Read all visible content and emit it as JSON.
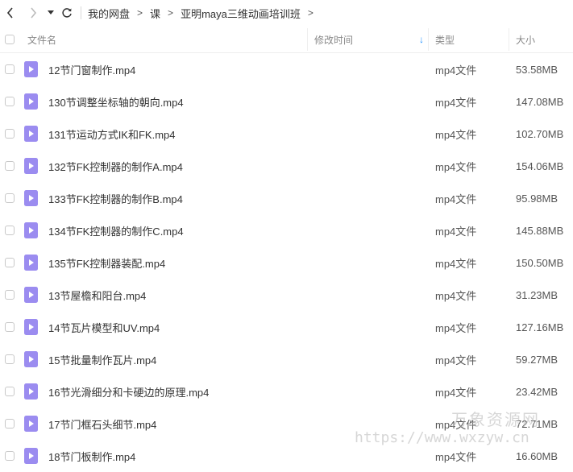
{
  "breadcrumb": [
    "我的网盘",
    "课",
    "亚明maya三维动画培训班"
  ],
  "breadcrumb_sep": ">",
  "columns": {
    "name": "文件名",
    "modified": "修改时间",
    "type": "类型",
    "size": "大小"
  },
  "sort_indicator": "↓",
  "files": [
    {
      "name": "12节门窗制作.mp4",
      "type": "mp4文件",
      "size": "53.58MB"
    },
    {
      "name": "130节调整坐标轴的朝向.mp4",
      "type": "mp4文件",
      "size": "147.08MB"
    },
    {
      "name": "131节运动方式IK和FK.mp4",
      "type": "mp4文件",
      "size": "102.70MB"
    },
    {
      "name": "132节FK控制器的制作A.mp4",
      "type": "mp4文件",
      "size": "154.06MB"
    },
    {
      "name": "133节FK控制器的制作B.mp4",
      "type": "mp4文件",
      "size": "95.98MB"
    },
    {
      "name": "134节FK控制器的制作C.mp4",
      "type": "mp4文件",
      "size": "145.88MB"
    },
    {
      "name": "135节FK控制器装配.mp4",
      "type": "mp4文件",
      "size": "150.50MB"
    },
    {
      "name": "13节屋檐和阳台.mp4",
      "type": "mp4文件",
      "size": "31.23MB"
    },
    {
      "name": "14节瓦片模型和UV.mp4",
      "type": "mp4文件",
      "size": "127.16MB"
    },
    {
      "name": "15节批量制作瓦片.mp4",
      "type": "mp4文件",
      "size": "59.27MB"
    },
    {
      "name": "16节光滑细分和卡硬边的原理.mp4",
      "type": "mp4文件",
      "size": "23.42MB"
    },
    {
      "name": "17节门框石头细节.mp4",
      "type": "mp4文件",
      "size": "72.71MB"
    },
    {
      "name": "18节门板制作.mp4",
      "type": "mp4文件",
      "size": "16.60MB"
    }
  ],
  "watermark": {
    "text": "万象资源网",
    "url": "https://www.wxzyw.cn"
  },
  "colors": {
    "file_icon": "#9b8cf0",
    "sort_arrow": "#1e90ff"
  }
}
